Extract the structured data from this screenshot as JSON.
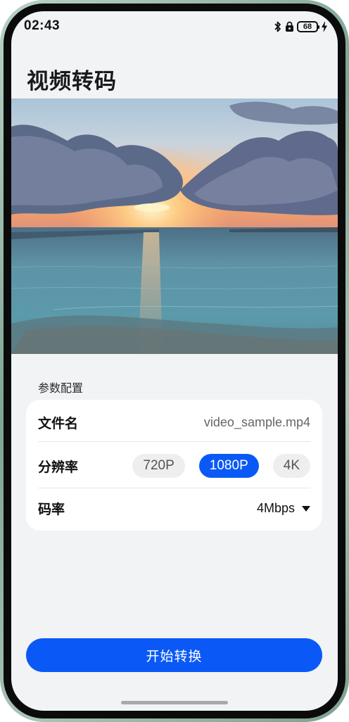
{
  "status_bar": {
    "time": "02:43",
    "battery_level": "68",
    "icons": [
      "bluetooth-icon",
      "lock-icon",
      "battery-icon",
      "charging-icon"
    ]
  },
  "header": {
    "title": "视频转码"
  },
  "preview": {
    "subject": "sunset-sea-image"
  },
  "config": {
    "section_title": "参数配置",
    "file_name_label": "文件名",
    "file_name_value": "video_sample.mp4",
    "resolution_label": "分辨率",
    "resolutions": [
      {
        "label": "720P",
        "selected": false
      },
      {
        "label": "1080P",
        "selected": true
      },
      {
        "label": "4K",
        "selected": false
      }
    ],
    "bitrate_label": "码率",
    "bitrate_value": "4Mbps"
  },
  "actions": {
    "start_label": "开始转换"
  },
  "colors": {
    "accent": "#0a59f7",
    "background": "#f1f3f5",
    "card": "#ffffff"
  }
}
